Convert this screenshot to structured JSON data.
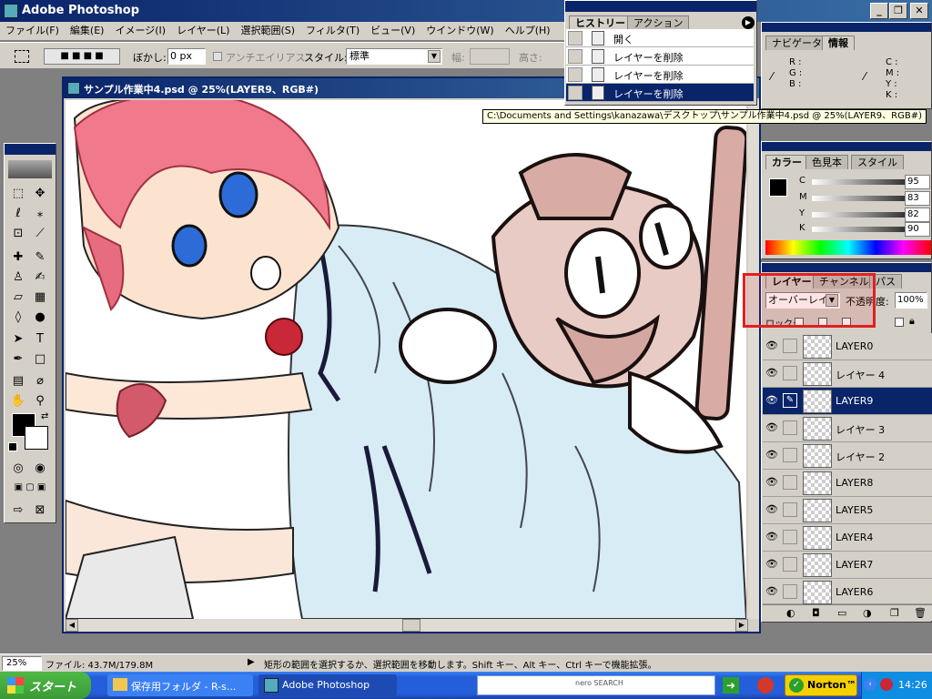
{
  "app": {
    "title": "Adobe Photoshop"
  },
  "menu": [
    "ファイル(F)",
    "編集(E)",
    "イメージ(I)",
    "レイヤー(L)",
    "選択範囲(S)",
    "フィルタ(T)",
    "ビュー(V)",
    "ウインドウ(W)",
    "ヘルプ(H)"
  ],
  "options": {
    "feather_label": "ぼかし:",
    "feather_value": "0 px",
    "antialias": "アンチエイリアス",
    "style_label": "スタイル:",
    "style_value": "標準",
    "width_label": "幅:",
    "height_label": "高さ:"
  },
  "document": {
    "title": "サンプル作業中4.psd @ 25%(LAYER9、RGB#)",
    "tooltip": "C:\\Documents and Settings\\kanazawa\\デスクトップ\\サンプル作業中4.psd @ 25%(LAYER9、RGB#)"
  },
  "history": {
    "tabs": [
      "ヒストリー",
      "アクション"
    ],
    "items": [
      {
        "label": "開く"
      },
      {
        "label": "レイヤーを削除"
      },
      {
        "label": "レイヤーを削除"
      },
      {
        "label": "レイヤーを削除",
        "selected": true
      }
    ]
  },
  "navigator": {
    "tabs": [
      "ナビゲータ",
      "情報"
    ],
    "rgb": [
      "R :",
      "G :",
      "B :"
    ],
    "cmyk": [
      "C :",
      "M :",
      "Y :",
      "K :"
    ]
  },
  "color": {
    "tabs": [
      "カラー",
      "色見本",
      "スタイル"
    ],
    "channels": [
      {
        "name": "C",
        "value": "95"
      },
      {
        "name": "M",
        "value": "83"
      },
      {
        "name": "Y",
        "value": "82"
      },
      {
        "name": "K",
        "value": "90"
      }
    ]
  },
  "layers": {
    "tabs": [
      "レイヤー",
      "チャンネル",
      "パス"
    ],
    "blend_mode": "オーバーレイ",
    "opacity_label": "不透明度:",
    "opacity_value": "100%",
    "lock_label": "ロック:",
    "items": [
      {
        "name": "LAYER0"
      },
      {
        "name": "レイヤー 4"
      },
      {
        "name": "LAYER9",
        "selected": true
      },
      {
        "name": "レイヤー 3"
      },
      {
        "name": "レイヤー 2"
      },
      {
        "name": "LAYER8"
      },
      {
        "name": "LAYER5"
      },
      {
        "name": "LAYER4"
      },
      {
        "name": "LAYER7"
      },
      {
        "name": "LAYER6"
      }
    ]
  },
  "status": {
    "zoom": "25%",
    "file_info": "ファイル: 43.7M/179.8M",
    "message": "矩形の範囲を選択するか、選択範囲を移動します。Shift キー、Alt キー、Ctrl キーで機能拡張。"
  },
  "taskbar": {
    "start": "スタート",
    "tasks": [
      "保存用フォルダ - R-s...",
      "Adobe Photoshop"
    ],
    "search_brand": "nero SEARCH",
    "norton": "Norton™",
    "clock": "14:26"
  },
  "colors": {
    "titlebar": "#0a246a",
    "highlight": "#e02020",
    "taskbar": "#245edb",
    "start": "#3c9a37"
  }
}
